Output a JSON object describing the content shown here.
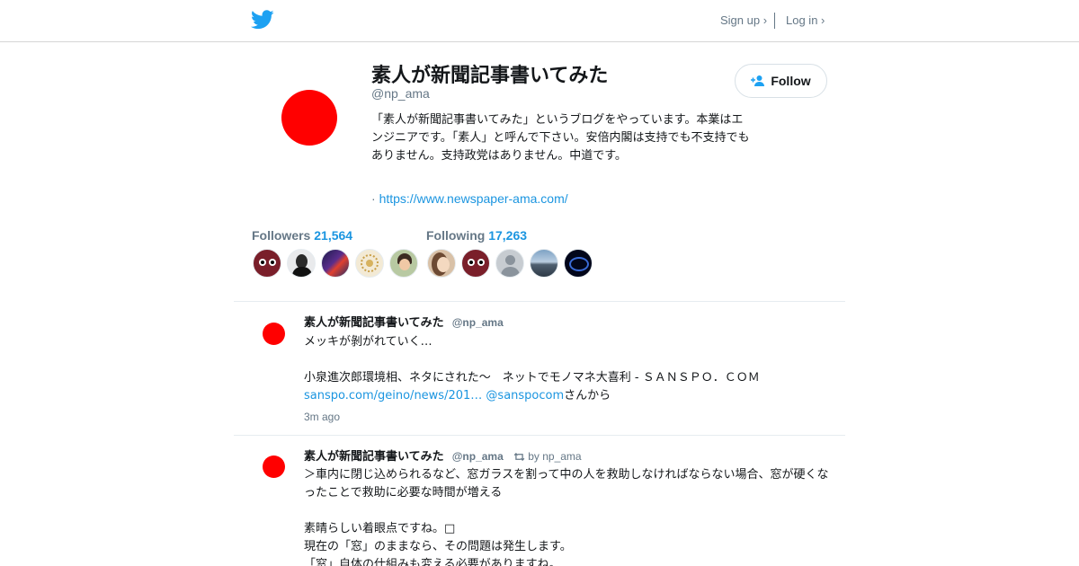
{
  "topbar": {
    "logo_icon": "twitter-bird-icon",
    "signup_label": "Sign up ›",
    "login_label": "Log in ›"
  },
  "profile": {
    "name": "素人が新聞記事書いてみた",
    "handle": "@np_ama",
    "bio": "「素人が新聞記事書いてみた」というブログをやっています。本業はエンジニアです。「素人」と呼んで下さい。安倍内閣は支持でも不支持でもありません。支持政党はありません。中道です。",
    "url_prefix": "·",
    "url": "https://www.newspaper-ama.com/",
    "follow_label": "Follow",
    "followers_label": "Followers",
    "followers_count": "21,564",
    "following_label": "Following",
    "following_count": "17,263"
  },
  "tweets": [
    {
      "name": "素人が新聞記事書いてみた",
      "handle": "@np_ama",
      "line1": "メッキが剝がれていく…",
      "line2": "小泉進次郎環境相、ネタにされた～　ネットでモノマネ大喜利 - ＳＡＮＳＰＯ．ＣＯＭ",
      "link": "sanspo.com/geino/news/201…",
      "mention": "@sanspocom",
      "suffix": "さんから",
      "time": "3m ago"
    },
    {
      "name": "素人が新聞記事書いてみた",
      "handle": "@np_ama",
      "retweet_by": "by np_ama",
      "line1": "＞車内に閉じ込められるなど、窓ガラスを割って中の人を救助しなければならない場合、窓が硬くなったことで救助に必要な時間が増える",
      "line2": "素晴らしい着眼点ですね。□",
      "line3": "現在の「窓」のままなら、その問題は発生します。",
      "line4": "「窓」自体の仕組みも変える必要がありますね。"
    }
  ],
  "colors": {
    "brand_blue": "#1da1f2",
    "link_blue": "#1b95e0",
    "avatar_red": "#ff0000",
    "muted_gray": "#657786"
  }
}
